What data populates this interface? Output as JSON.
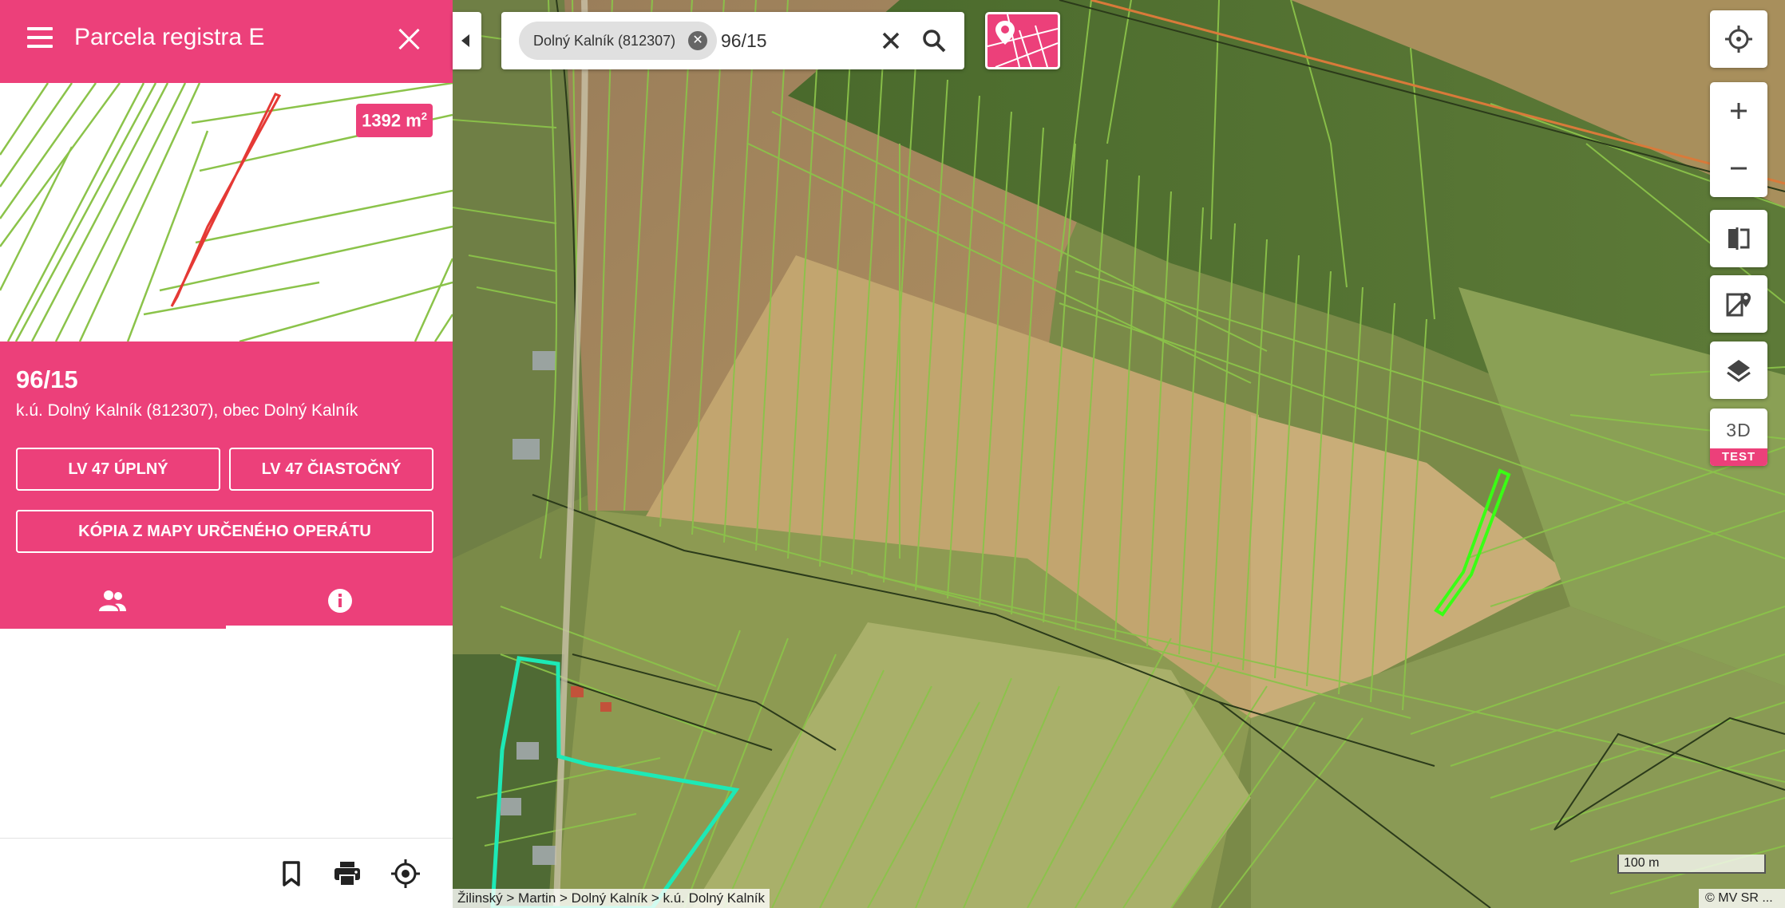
{
  "panel": {
    "title": "Parcela registra E",
    "area": {
      "value": "1392 m",
      "unit_sup": "2"
    },
    "parcel_number": "96/15",
    "location": "k.ú. Dolný Kalník (812307), obec Dolný Kalník",
    "buttons": {
      "lv_full": "LV 47 ÚPLNÝ",
      "lv_partial": "LV 47 ČIASTOČNÝ",
      "map_copy": "KÓPIA Z MAPY URČENÉHO OPERÁTU"
    },
    "tabs": [
      {
        "icon": "people-icon",
        "active": false
      },
      {
        "icon": "info-icon",
        "active": true
      }
    ],
    "footer_icons": [
      "bookmark-icon",
      "print-icon",
      "locate-icon"
    ]
  },
  "search": {
    "chip": "Dolný Kalník (812307)",
    "query": "96/15"
  },
  "map_controls": {
    "three_d_label": "3D",
    "test_label": "TEST"
  },
  "scale": "100 m",
  "copyright": "© MV SR ...",
  "breadcrumb": {
    "items": [
      "Žilinský",
      "Martin",
      "Dolný Kalník",
      "k.ú. Dolný Kalník"
    ],
    "separator": " > "
  },
  "colors": {
    "accent": "#ec407a",
    "parcel_lines": "#8bc34a",
    "selected_parcel": "#39ff14",
    "highlight_area": "#1de9b6"
  }
}
